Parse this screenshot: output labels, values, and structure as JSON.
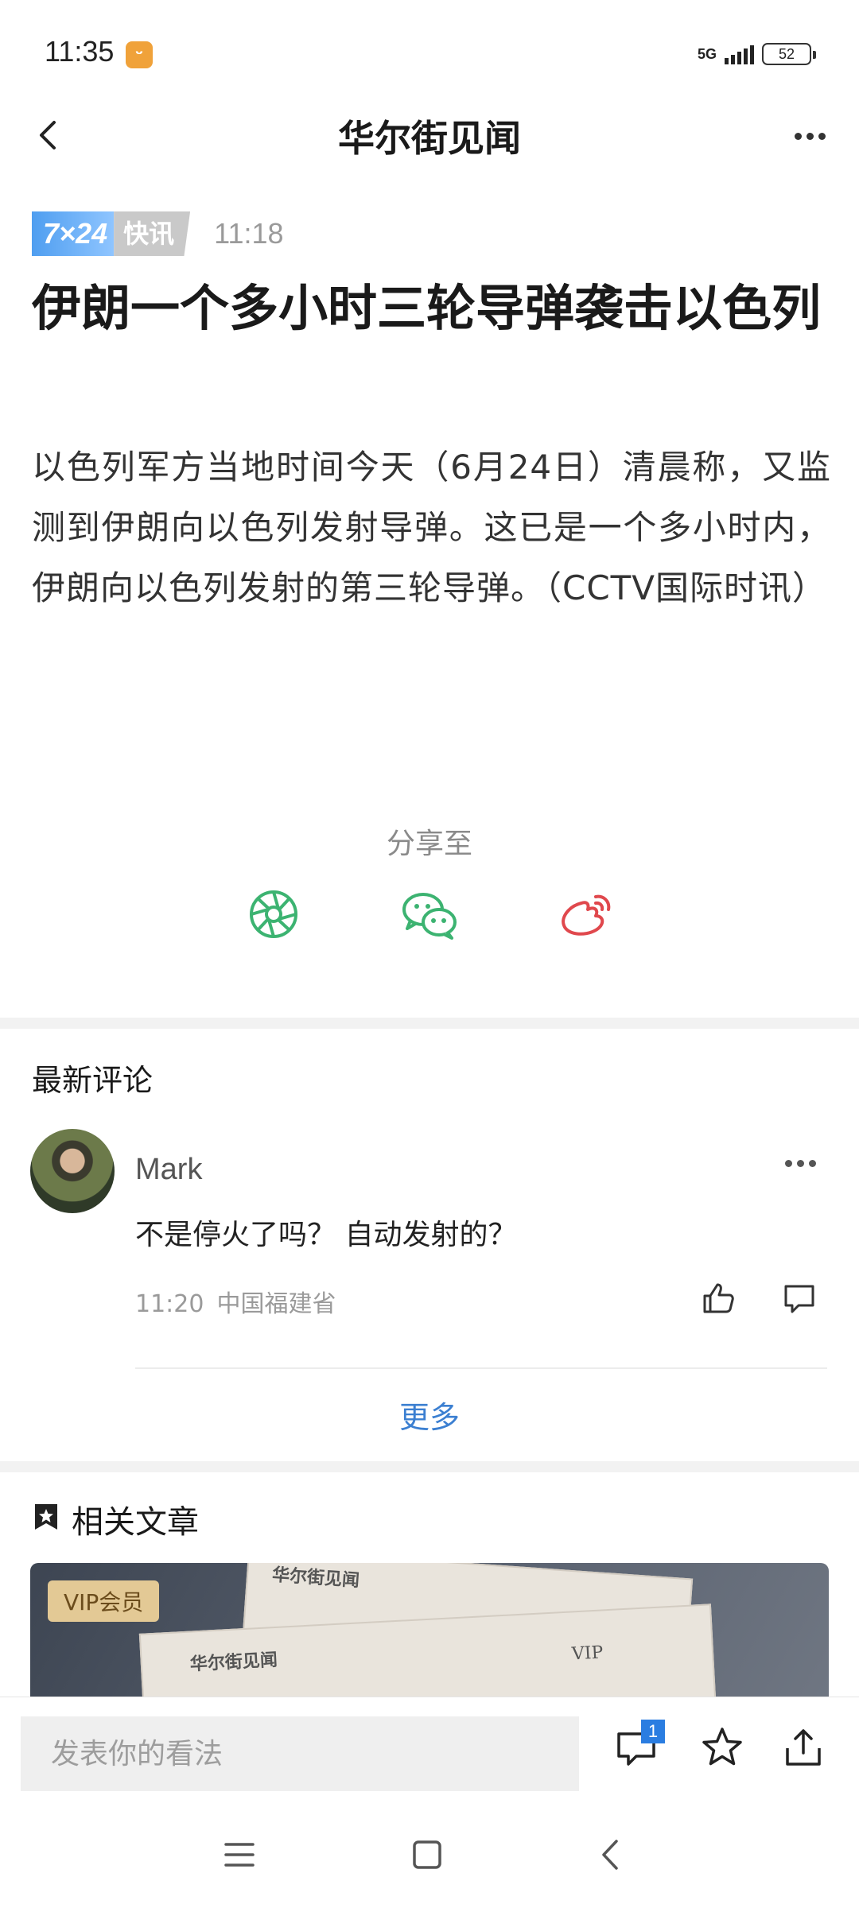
{
  "status_bar": {
    "time": "11:35",
    "network": "5G",
    "battery": "52"
  },
  "header": {
    "title": "华尔街见闻"
  },
  "article": {
    "badge_left": "7×24",
    "badge_right": "快讯",
    "time": "11:18",
    "title": "伊朗一个多小时三轮导弹袭击以色列",
    "body": "以色列军方当地时间今天（6月24日）清晨称，又监测到伊朗向以色列发射导弹。这已是一个多小时内，伊朗向以色列发射的第三轮导弹。（CCTV国际时讯）"
  },
  "share": {
    "label": "分享至",
    "icons": [
      "moments-icon",
      "wechat-icon",
      "weibo-icon"
    ],
    "colors": {
      "moments": "#3cb371",
      "wechat": "#3cb371",
      "weibo": "#e0484d"
    }
  },
  "comments": {
    "section_title": "最新评论",
    "items": [
      {
        "user": "Mark",
        "text": "不是停火了吗？ 自动发射的？",
        "time": "11:20",
        "location": "中国福建省"
      }
    ],
    "more_label": "更多"
  },
  "related": {
    "section_title": "相关文章",
    "card_tag": "VIP会员",
    "paper_logo": "华尔街见闻",
    "paper_mark": "VIP"
  },
  "bottom_bar": {
    "input_placeholder": "发表你的看法",
    "comment_count": "1"
  },
  "theme": {
    "accent": "#2a7de1",
    "link": "#3b7fd1"
  }
}
